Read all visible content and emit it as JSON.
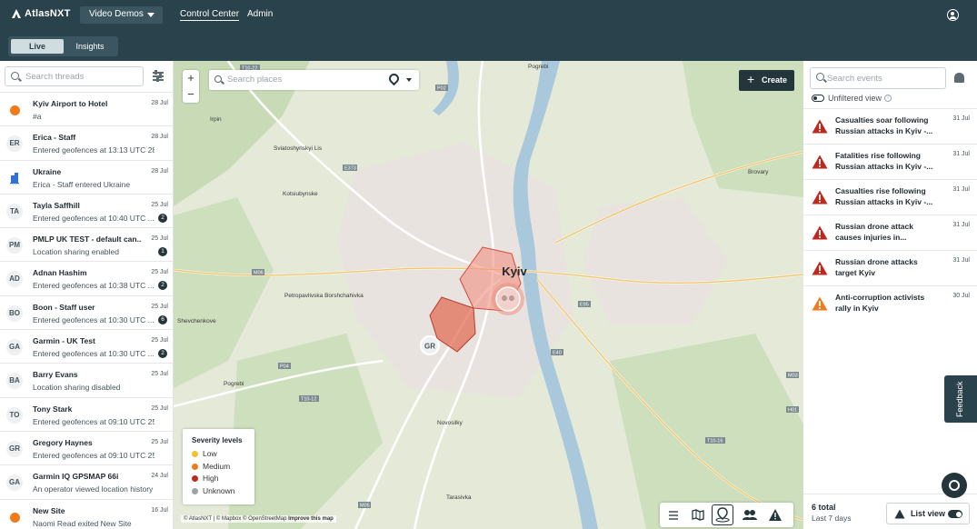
{
  "app": {
    "name": "AtlasNXT",
    "workspace": "Video Demos",
    "nav": [
      "Control Center",
      "Admin"
    ],
    "active_nav": "Control Center"
  },
  "view_toggle": {
    "options": [
      "Live",
      "Insights"
    ],
    "selected": "Live"
  },
  "threads": {
    "search_placeholder": "Search threads",
    "items": [
      {
        "avatar": "",
        "avatar_type": "dot",
        "name": "Kyiv Airport to Hotel",
        "sub": "#a",
        "date": "28 Jul",
        "badge": ""
      },
      {
        "avatar": "ER",
        "avatar_type": "initials",
        "name": "Erica - Staff",
        "sub": "Entered geofences at 13:13 UTC 28 ...",
        "date": "28 Jul",
        "badge": ""
      },
      {
        "avatar": "",
        "avatar_type": "building",
        "name": "Ukraine",
        "sub": "Erica - Staff entered Ukraine",
        "date": "28 Jul",
        "badge": ""
      },
      {
        "avatar": "TA",
        "avatar_type": "initials",
        "name": "Tayla Saffhill",
        "sub": "Entered geofences at 10:40 UTC ...",
        "date": "25 Jul",
        "badge": "2"
      },
      {
        "avatar": "PM",
        "avatar_type": "initials",
        "name": "PMLP UK TEST - default can...",
        "sub": "Location sharing enabled",
        "date": "25 Jul",
        "badge": "1"
      },
      {
        "avatar": "AD",
        "avatar_type": "initials",
        "name": "Adnan Hashim",
        "sub": "Entered geofences at 10:38 UTC ...",
        "date": "25 Jul",
        "badge": "2"
      },
      {
        "avatar": "BO",
        "avatar_type": "initials",
        "name": "Boon - Staff user",
        "sub": "Entered geofences at 10:30 UTC ...",
        "date": "25 Jul",
        "badge": "6"
      },
      {
        "avatar": "GA",
        "avatar_type": "initials",
        "name": "Garmin - UK Test",
        "sub": "Entered geofences at 10:30 UTC ...",
        "date": "25 Jul",
        "badge": "2"
      },
      {
        "avatar": "BA",
        "avatar_type": "initials",
        "name": "Barry Evans",
        "sub": "Location sharing disabled",
        "date": "25 Jul",
        "badge": ""
      },
      {
        "avatar": "TO",
        "avatar_type": "initials",
        "name": "Tony Stark",
        "sub": "Entered geofences at 09:10 UTC 25 ...",
        "date": "25 Jul",
        "badge": ""
      },
      {
        "avatar": "GR",
        "avatar_type": "initials",
        "name": "Gregory Haynes",
        "sub": "Entered geofences at 09:10 UTC 25 ...",
        "date": "25 Jul",
        "badge": ""
      },
      {
        "avatar": "GA",
        "avatar_type": "initials",
        "name": "Garmin IQ GPSMAP 66i",
        "sub": "An operator viewed location history ...",
        "date": "24 Jul",
        "badge": ""
      },
      {
        "avatar": "",
        "avatar_type": "dot",
        "name": "New Site",
        "sub": "Naomi Read exited New Site",
        "date": "16 Jul",
        "badge": ""
      }
    ]
  },
  "map": {
    "search_placeholder": "Search places",
    "create_label": "Create",
    "legend": {
      "title": "Severity levels",
      "items": [
        {
          "label": "Low",
          "color": "#f2c232"
        },
        {
          "label": "Medium",
          "color": "#f07b1d"
        },
        {
          "label": "High",
          "color": "#c0281e"
        },
        {
          "label": "Unknown",
          "color": "#9aa4a9"
        }
      ]
    },
    "attribution": [
      "© AtlasNXT",
      "© Mapbox",
      "© OpenStreetMap",
      "Improve this map"
    ],
    "labels": {
      "city": "Kyiv",
      "marker": "GR",
      "places": [
        "Brovary",
        "Irpin",
        "Sviatoshynskyi Lis",
        "Kotsiubynske",
        "Petropavlivska Borshchahivka",
        "Horenychi",
        "Shevchenkove",
        "Khotiv",
        "Novosilky",
        "Pogrebi",
        "Tarasivka"
      ],
      "roads": [
        "T10-22",
        "P02",
        "E373",
        "E95",
        "M06",
        "P04",
        "E40",
        "T10-12",
        "T10-16",
        "M03",
        "M05",
        "H01"
      ]
    }
  },
  "events": {
    "search_placeholder": "Search events",
    "unfiltered_label": "Unfiltered view",
    "items": [
      {
        "title": "Casualties soar following Russian attacks in Kyiv -...",
        "date": "31 Jul",
        "severity": "High",
        "color": "#c0281e"
      },
      {
        "title": "Fatalities rise following Russian attacks in Kyiv -...",
        "date": "31 Jul",
        "severity": "High",
        "color": "#c0281e"
      },
      {
        "title": "Casualties rise following Russian attacks in Kyiv -...",
        "date": "31 Jul",
        "severity": "High",
        "color": "#c0281e"
      },
      {
        "title": "Russian drone attack causes injuries in...",
        "date": "31 Jul",
        "severity": "High",
        "color": "#c0281e"
      },
      {
        "title": "Russian drone attacks target Kyiv",
        "date": "31 Jul",
        "severity": "High",
        "color": "#c0281e"
      },
      {
        "title": "Anti-corruption activists rally in Kyiv",
        "date": "30 Jul",
        "severity": "Medium",
        "color": "#f07b1d"
      }
    ],
    "total": "6 total",
    "range": "Last 7 days",
    "list_view_label": "List view"
  },
  "feedback_label": "Feedback"
}
